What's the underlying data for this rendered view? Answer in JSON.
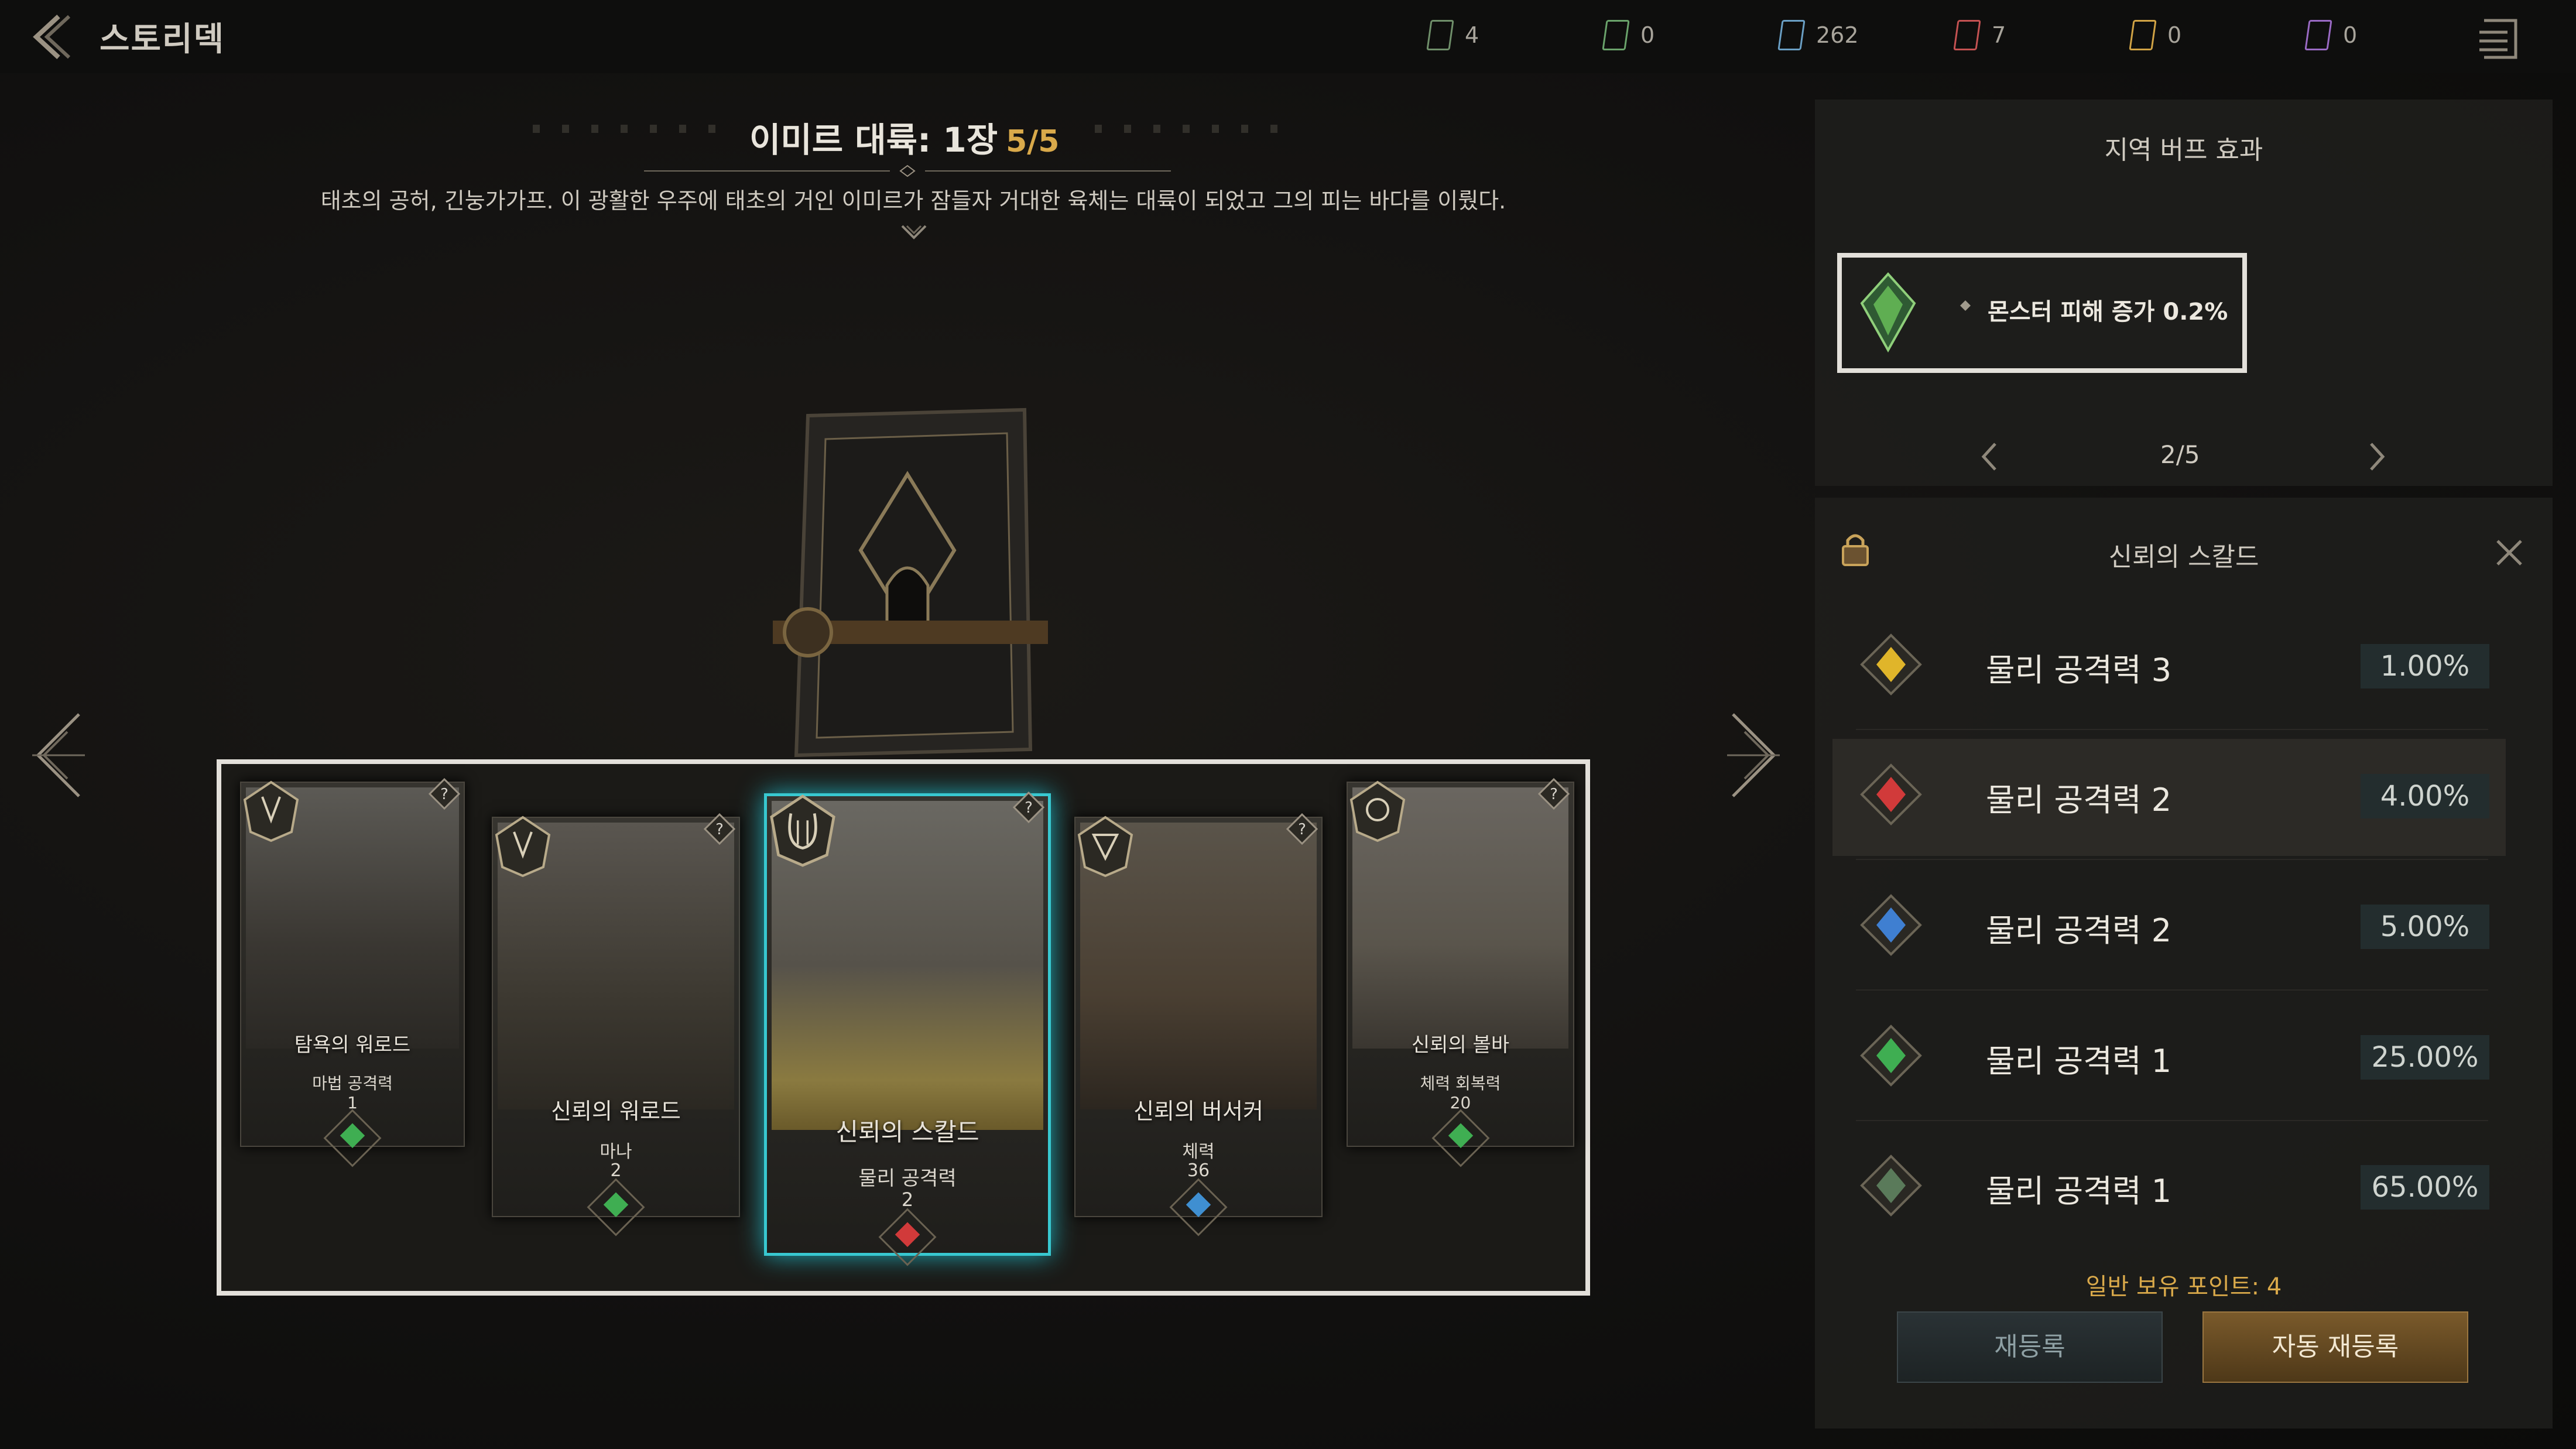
{
  "header": {
    "title": "스토리덱",
    "currencies": [
      {
        "value": "4",
        "color": "#6f8f6a"
      },
      {
        "value": "0",
        "color": "#6aa36b"
      },
      {
        "value": "262",
        "color": "#6a9fc4"
      },
      {
        "value": "7",
        "color": "#c45252"
      },
      {
        "value": "0",
        "color": "#d1a345"
      },
      {
        "value": "0",
        "color": "#9a6ac4"
      }
    ]
  },
  "chapter": {
    "title": "이미르 대륙: 1장",
    "progress": "5/5",
    "description": "태초의 공허, 긴눙가가프. 이 광활한 우주에 태초의 거인 이미르가 잠들자 거대한 육체는 대륙이 되었고 그의 피는 바다를 이뤘다."
  },
  "cards": [
    {
      "name": "탐욕의 워로드",
      "stat": "마법 공격력",
      "value": "1",
      "gem_color": "#3fae52"
    },
    {
      "name": "신뢰의 워로드",
      "stat": "마나",
      "value": "2",
      "gem_color": "#3fae52"
    },
    {
      "name": "신뢰의 스칼드",
      "stat": "물리 공격력",
      "value": "2",
      "gem_color": "#d13a3a"
    },
    {
      "name": "신뢰의 버서커",
      "stat": "체력",
      "value": "36",
      "gem_color": "#3f8fd1"
    },
    {
      "name": "신뢰의 볼바",
      "stat": "체력 회복력",
      "value": "20",
      "gem_color": "#3fae52"
    }
  ],
  "buff_panel": {
    "title": "지역 버프 효과",
    "item_text": "몬스터 피해 증가 0.2%",
    "page": "2/5"
  },
  "deck_panel": {
    "title": "신뢰의 스칼드",
    "rows": [
      {
        "label": "물리 공격력 3",
        "pct": "1.00%",
        "gem_color": "#e0b52a"
      },
      {
        "label": "물리 공격력 2",
        "pct": "4.00%",
        "gem_color": "#d13a3a"
      },
      {
        "label": "물리 공격력 2",
        "pct": "5.00%",
        "gem_color": "#3f7fd1"
      },
      {
        "label": "물리 공격력 1",
        "pct": "25.00%",
        "gem_color": "#3fae52"
      },
      {
        "label": "물리 공격력 1",
        "pct": "65.00%",
        "gem_color": "#5a7a5a"
      }
    ],
    "points": "일반 보유 포인트: 4",
    "reregister_label": "재등록",
    "auto_reregister_label": "자동 재등록"
  }
}
